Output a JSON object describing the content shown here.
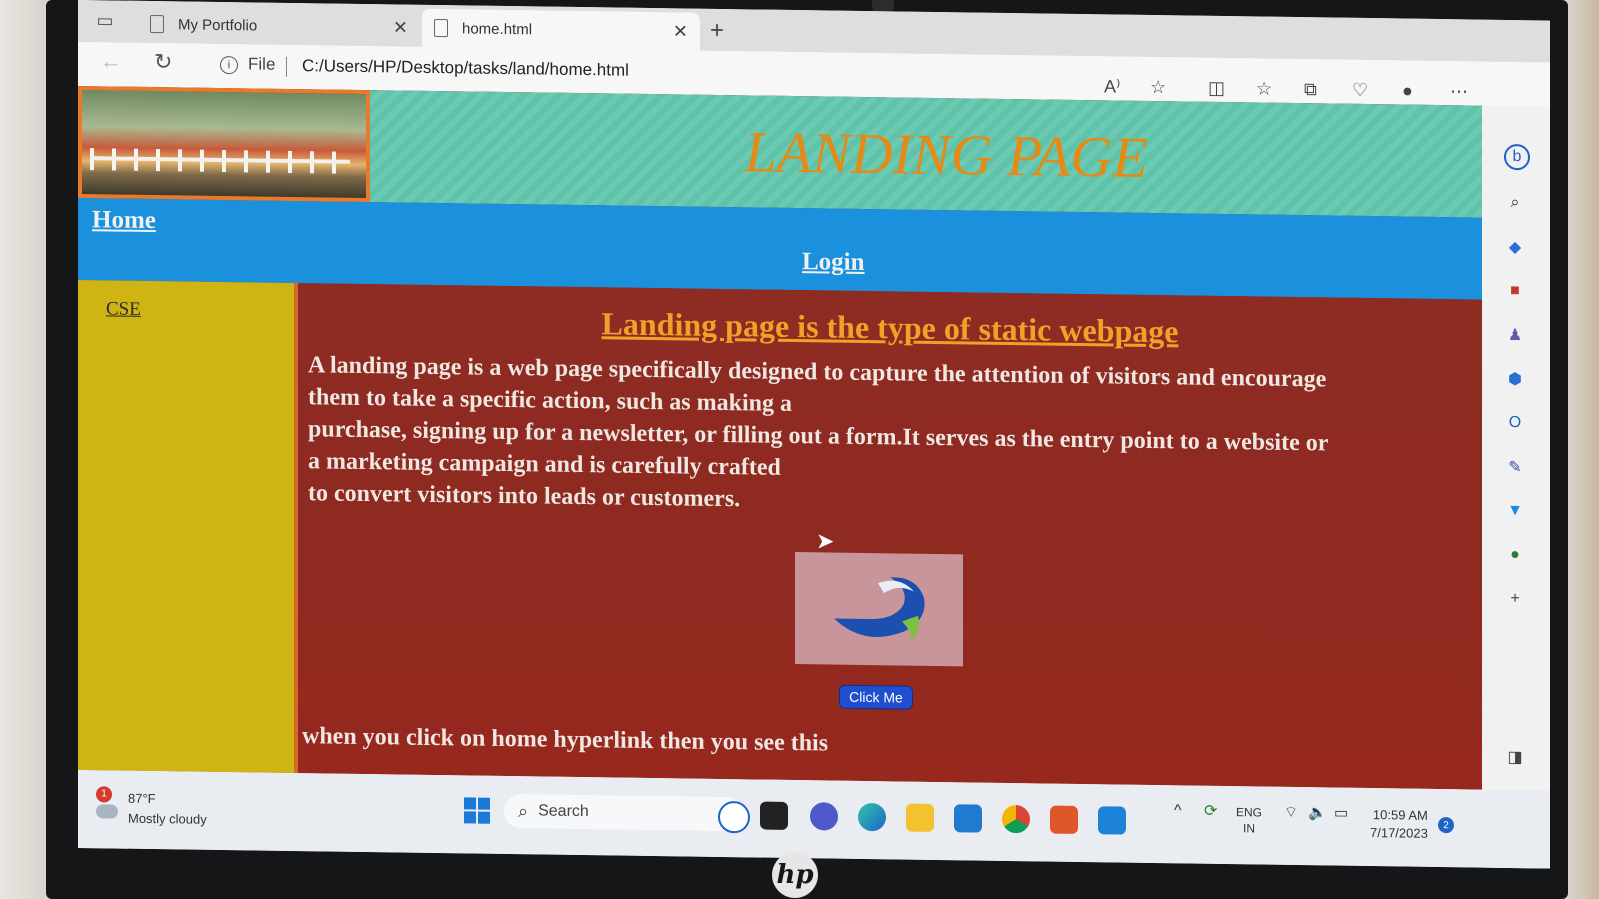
{
  "browser": {
    "tabs": [
      {
        "label": "My Portfolio",
        "active": false
      },
      {
        "label": "home.html",
        "active": true
      }
    ],
    "new_tab_label": "+",
    "address": {
      "info_label": "i",
      "scheme_label": "File",
      "url": "C:/Users/HP/Desktop/tasks/land/home.html"
    }
  },
  "page": {
    "banner_title": "LANDING PAGE",
    "nav": {
      "home": "Home",
      "login": "Login"
    },
    "sidebar_link": "CSE",
    "heading": "Landing page is the type of static webpage",
    "paragraph_lines": [
      "A landing page is a web page specifically designed to capture the attention of visitors and encourage",
      "them to take a specific action, such as making a",
      "purchase, signing up for a newsletter, or filling out a form.It serves as the entry point to a website or",
      "a marketing campaign and is carefully crafted",
      "to convert visitors into leads or customers."
    ],
    "button_label": "Click Me",
    "footer_note": "when you click on home hyperlink then you see this"
  },
  "taskbar": {
    "weather": {
      "badge": "1",
      "temperature": "87°F",
      "condition": "Mostly cloudy"
    },
    "search_placeholder": "Search",
    "language": {
      "line1": "ENG",
      "line2": "IN"
    },
    "time": "10:59 AM",
    "date": "7/17/2023",
    "notification_count": "2"
  },
  "colors": {
    "banner_title": "#e48a16",
    "navbar": "#1b91de",
    "sidebar": "#cfb414",
    "content_bg": "#8f2b22",
    "heading": "#f0a228",
    "button": "#1f4ed1"
  }
}
